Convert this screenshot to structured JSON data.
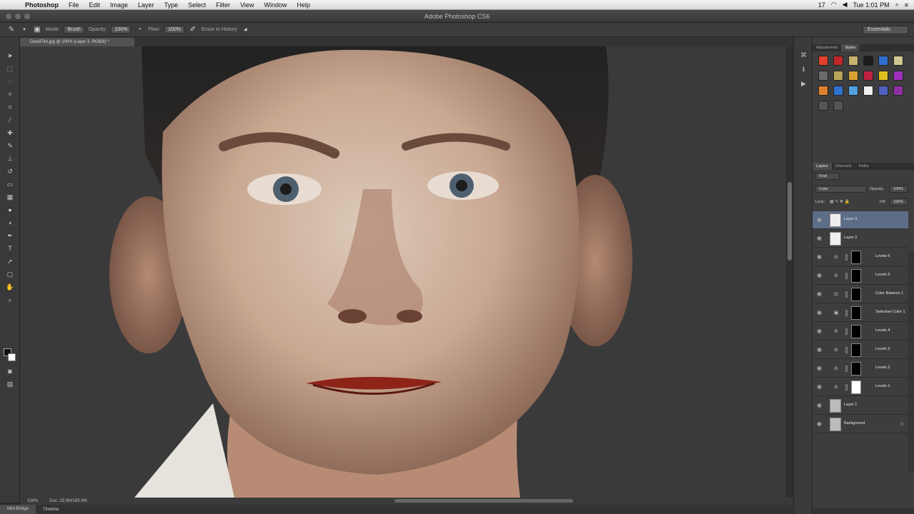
{
  "menubar": {
    "apple": "",
    "app_name": "Photoshop",
    "items": [
      "File",
      "Edit",
      "Image",
      "Layer",
      "Type",
      "Select",
      "Filter",
      "View",
      "Window",
      "Help"
    ],
    "clock": "Tue 1:01 PM",
    "battery_badge": "17"
  },
  "window": {
    "title": "Adobe Photoshop CS6"
  },
  "options_bar": {
    "mode_label": "Mode:",
    "mode_value": "Brush",
    "opacity_label": "Opacity:",
    "opacity_value": "100%",
    "flow_label": "Flow:",
    "flow_value": "100%",
    "erase_history": "Erase to History",
    "workspace": "Essentials"
  },
  "document": {
    "tab_label": "DavidTim.jpg @ 100% (Layer 3, RGB/8) *"
  },
  "status": {
    "zoom": "100%",
    "doc_size": "Doc: 29.9M/185.9M"
  },
  "bottom_tabs": [
    "Mini Bridge",
    "Timeline"
  ],
  "panels": {
    "top_tabs": [
      "Adjustments",
      "Styles"
    ],
    "style_colors": [
      "#e0402a",
      "#c0262a",
      "#c8b070",
      "#1b1b1b",
      "#2f6fd0",
      "#d0c890",
      "#6a6a6a",
      "#b8a45a",
      "#d8a030",
      "#c02040",
      "#e0c020",
      "#a030c0",
      "#e08030",
      "#3070d0",
      "#50a0e0",
      "#f0f0f0",
      "#5060c0",
      "#9030a0",
      "#555555",
      "#555555"
    ],
    "layer_tabs": [
      "Layers",
      "Channels",
      "Paths"
    ],
    "filter_kind": "Kind",
    "blend_mode": "Color",
    "opacity_label": "Opacity:",
    "opacity_value": "100%",
    "lock_label": "Lock:",
    "fill_label": "Fill:",
    "fill_value": "100%",
    "layers": [
      {
        "name": "Layer 3",
        "type": "pixel",
        "selected": true
      },
      {
        "name": "Layer 2",
        "type": "pixel",
        "selected": false
      },
      {
        "name": "Levels 6",
        "type": "levels",
        "selected": false
      },
      {
        "name": "Levels 5",
        "type": "levels",
        "selected": false
      },
      {
        "name": "Color Balance 1",
        "type": "balance",
        "selected": false
      },
      {
        "name": "Selective Color 1",
        "type": "selective",
        "selected": false
      },
      {
        "name": "Levels 4",
        "type": "levels",
        "selected": false
      },
      {
        "name": "Levels 3",
        "type": "levels",
        "selected": false
      },
      {
        "name": "Levels 2",
        "type": "levels",
        "selected": false
      },
      {
        "name": "Levels 1",
        "type": "levels",
        "selected": false
      },
      {
        "name": "Layer 1",
        "type": "pixel",
        "selected": false
      },
      {
        "name": "Background",
        "type": "background",
        "selected": false
      }
    ]
  }
}
